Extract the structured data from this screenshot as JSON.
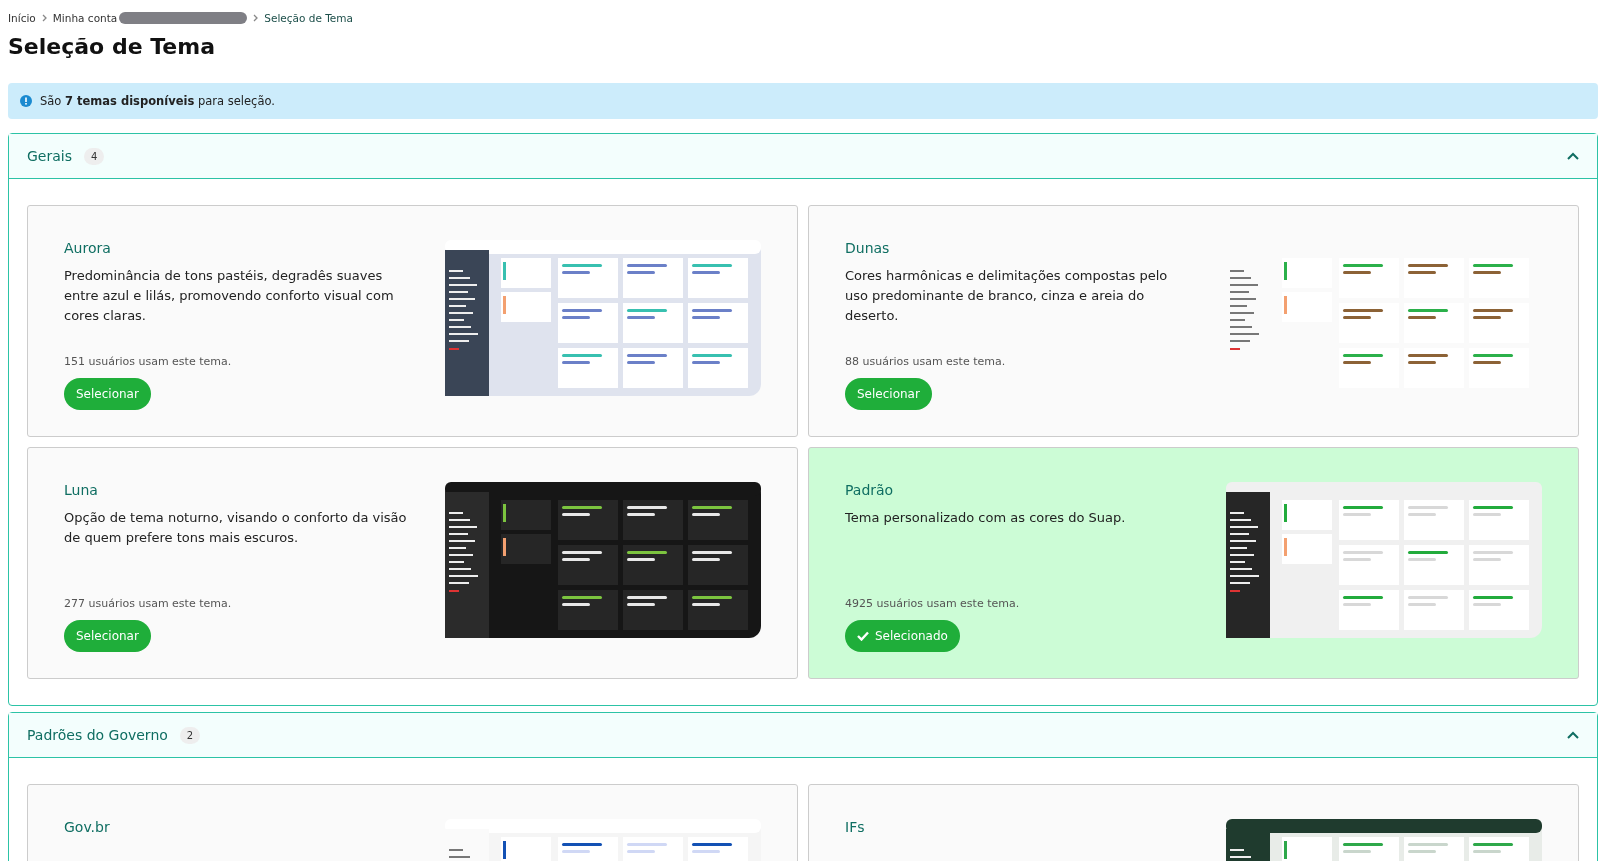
{
  "breadcrumb": [
    {
      "label": "Início"
    },
    {
      "label": "Minha conta",
      "redacted": true
    },
    {
      "label": "Seleção de Tema"
    }
  ],
  "title": "Seleção de Tema",
  "info": "São **7 temas disponíveis** para seleção.",
  "sections": [
    {
      "title": "Gerais",
      "count": "4",
      "expanded": true,
      "themes": [
        {
          "name": "Aurora",
          "description": "Predominância de tons pastéis, degradês suaves entre azul e lilás, promovendo conforto visual com cores claras.",
          "users": "151 usuários usam este tema.",
          "button": "Selecionar",
          "selected": false,
          "kind": "aurora"
        },
        {
          "name": "Dunas",
          "description": "Cores harmônicas e delimitações compostas pelo uso predominante de branco, cinza e areia do deserto.",
          "users": "88 usuários usam este tema.",
          "button": "Selecionar",
          "selected": false,
          "kind": "dunas"
        },
        {
          "name": "Luna",
          "description": "Opção de tema noturno, visando o conforto da visão de quem prefere tons mais escuros.",
          "users": "277 usuários usam este tema.",
          "button": "Selecionar",
          "selected": false,
          "kind": "luna"
        },
        {
          "name": "Padrão",
          "description": "Tema personalizado com as cores do Suap.",
          "users": "4925 usuários usam este tema.",
          "button": "Selecionado",
          "selected": true,
          "kind": "padrao"
        }
      ]
    },
    {
      "title": "Padrões do Governo",
      "count": "2",
      "expanded": true,
      "themes": [
        {
          "name": "Gov.br",
          "selected": false,
          "kind": "govbr"
        },
        {
          "name": "IFs",
          "selected": false,
          "kind": "ifs"
        }
      ]
    }
  ]
}
